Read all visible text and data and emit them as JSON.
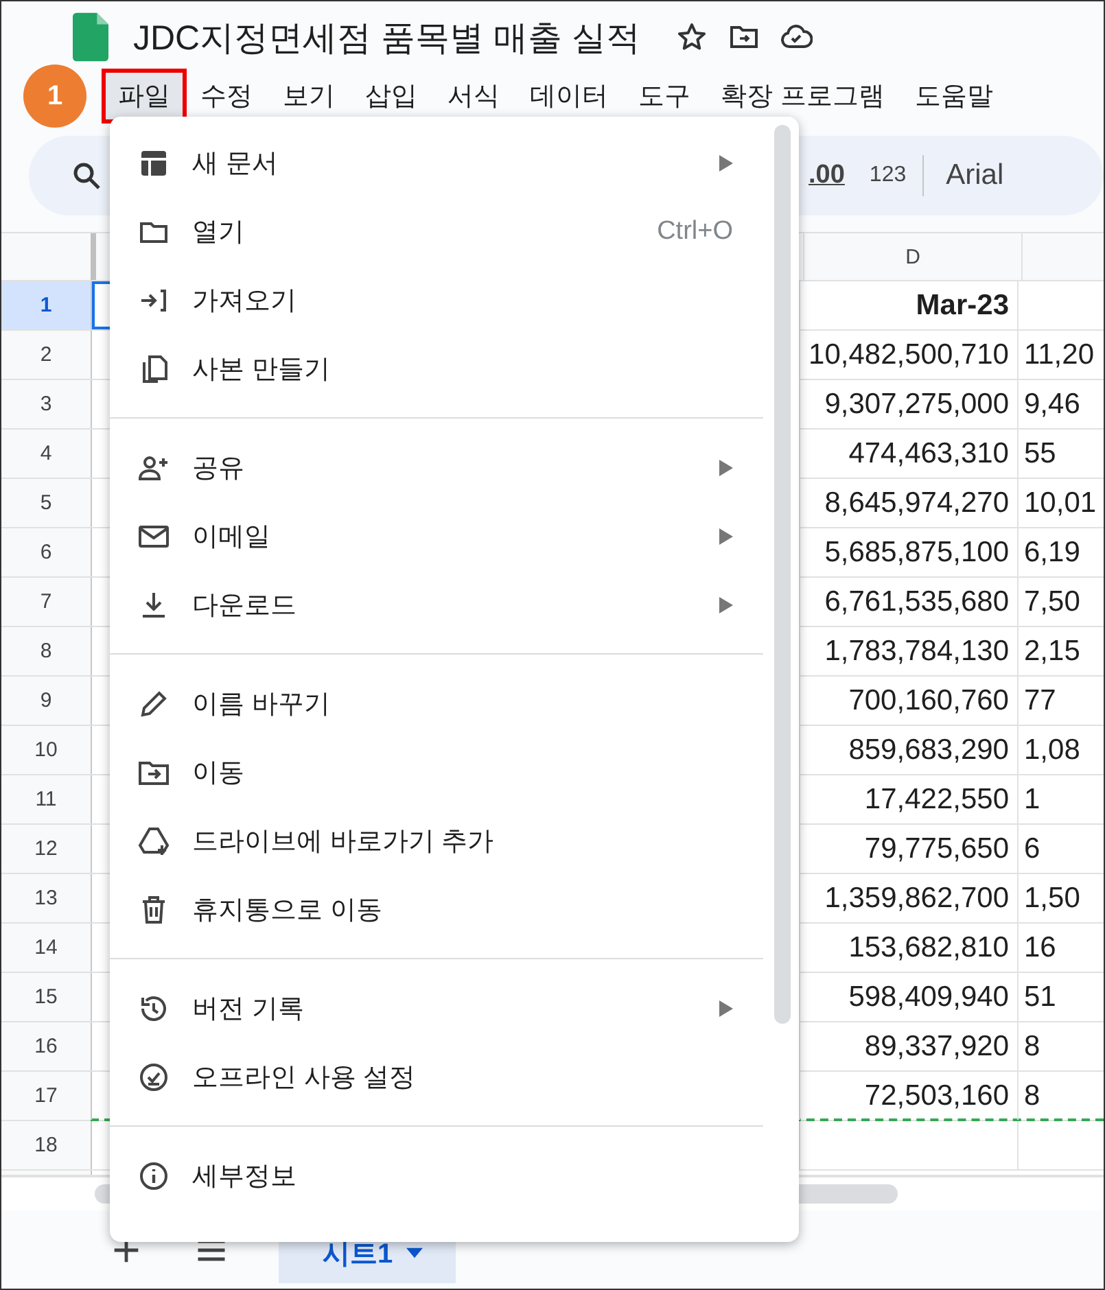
{
  "document": {
    "title": "JDC지정면세점 품목별 매출 실적"
  },
  "menubar": {
    "badge": "1",
    "items": [
      {
        "label": "파일",
        "selected": true
      },
      {
        "label": "수정",
        "selected": false
      },
      {
        "label": "보기",
        "selected": false
      },
      {
        "label": "삽입",
        "selected": false
      },
      {
        "label": "서식",
        "selected": false
      },
      {
        "label": "데이터",
        "selected": false
      },
      {
        "label": "도구",
        "selected": false
      },
      {
        "label": "확장 프로그램",
        "selected": false
      },
      {
        "label": "도움말",
        "selected": false
      }
    ]
  },
  "toolbar": {
    "decimal": ".00",
    "number_format": "123",
    "font": "Arial"
  },
  "grid": {
    "column_header": "D",
    "rows": [
      {
        "number": "1",
        "d": "Mar-23",
        "e": "",
        "selected": true,
        "bold": true
      },
      {
        "number": "2",
        "d": "10,482,500,710",
        "e": "11,20",
        "selected": false,
        "bold": false
      },
      {
        "number": "3",
        "d": "9,307,275,000",
        "e": "9,46",
        "selected": false,
        "bold": false
      },
      {
        "number": "4",
        "d": "474,463,310",
        "e": "55",
        "selected": false,
        "bold": false
      },
      {
        "number": "5",
        "d": "8,645,974,270",
        "e": "10,01",
        "selected": false,
        "bold": false
      },
      {
        "number": "6",
        "d": "5,685,875,100",
        "e": "6,19",
        "selected": false,
        "bold": false
      },
      {
        "number": "7",
        "d": "6,761,535,680",
        "e": "7,50",
        "selected": false,
        "bold": false
      },
      {
        "number": "8",
        "d": "1,783,784,130",
        "e": "2,15",
        "selected": false,
        "bold": false
      },
      {
        "number": "9",
        "d": "700,160,760",
        "e": "77",
        "selected": false,
        "bold": false
      },
      {
        "number": "10",
        "d": "859,683,290",
        "e": "1,08",
        "selected": false,
        "bold": false
      },
      {
        "number": "11",
        "d": "17,422,550",
        "e": "1",
        "selected": false,
        "bold": false
      },
      {
        "number": "12",
        "d": "79,775,650",
        "e": "6",
        "selected": false,
        "bold": false
      },
      {
        "number": "13",
        "d": "1,359,862,700",
        "e": "1,50",
        "selected": false,
        "bold": false
      },
      {
        "number": "14",
        "d": "153,682,810",
        "e": "16",
        "selected": false,
        "bold": false
      },
      {
        "number": "15",
        "d": "598,409,940",
        "e": "51",
        "selected": false,
        "bold": false
      },
      {
        "number": "16",
        "d": "89,337,920",
        "e": "8",
        "selected": false,
        "bold": false
      },
      {
        "number": "17",
        "d": "72,503,160",
        "e": "8",
        "selected": false,
        "bold": false
      },
      {
        "number": "18",
        "selected": false
      }
    ]
  },
  "file_menu": {
    "groups": [
      [
        {
          "label": "새 문서",
          "submenu": true
        },
        {
          "label": "열기",
          "shortcut": "Ctrl+O",
          "submenu": false
        },
        {
          "label": "가져오기",
          "submenu": false
        },
        {
          "label": "사본 만들기",
          "submenu": false
        }
      ],
      [
        {
          "label": "공유",
          "submenu": true
        },
        {
          "label": "이메일",
          "submenu": true
        },
        {
          "label": "다운로드",
          "submenu": true
        }
      ],
      [
        {
          "label": "이름 바꾸기",
          "submenu": false
        },
        {
          "label": "이동",
          "submenu": false
        },
        {
          "label": "드라이브에 바로가기 추가",
          "submenu": false
        },
        {
          "label": "휴지통으로 이동",
          "submenu": false
        }
      ],
      [
        {
          "label": "버전 기록",
          "submenu": true
        },
        {
          "label": "오프라인 사용 설정",
          "submenu": false
        }
      ],
      [
        {
          "label": "세부정보",
          "submenu": false
        }
      ]
    ]
  },
  "sheet_tabs": [
    {
      "label": "시트1",
      "selected": true
    }
  ]
}
